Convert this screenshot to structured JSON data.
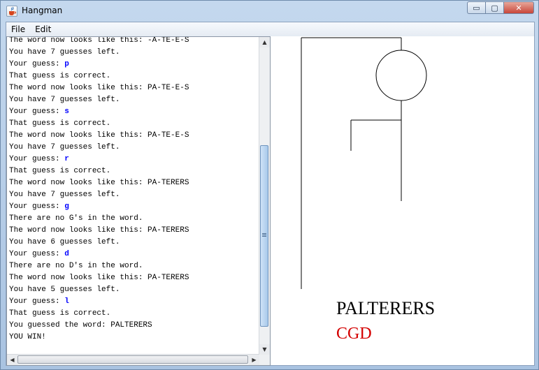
{
  "window": {
    "title": "Hangman",
    "controls": {
      "minimize": "▭",
      "maximize": "▢",
      "close": "✕"
    }
  },
  "menubar": {
    "items": [
      "File",
      "Edit"
    ]
  },
  "console": {
    "lines": [
      [
        {
          "text": "The word now looks like this: -A-TE-E-S"
        }
      ],
      [
        {
          "text": "You have 7 guesses left."
        }
      ],
      [
        {
          "text": "Your guess: "
        },
        {
          "text": "p",
          "guess": true
        }
      ],
      [
        {
          "text": "That guess is correct."
        }
      ],
      [
        {
          "text": "The word now looks like this: PA-TE-E-S"
        }
      ],
      [
        {
          "text": "You have 7 guesses left."
        }
      ],
      [
        {
          "text": "Your guess: "
        },
        {
          "text": "s",
          "guess": true
        }
      ],
      [
        {
          "text": "That guess is correct."
        }
      ],
      [
        {
          "text": "The word now looks like this: PA-TE-E-S"
        }
      ],
      [
        {
          "text": "You have 7 guesses left."
        }
      ],
      [
        {
          "text": "Your guess: "
        },
        {
          "text": "r",
          "guess": true
        }
      ],
      [
        {
          "text": "That guess is correct."
        }
      ],
      [
        {
          "text": "The word now looks like this: PA-TERERS"
        }
      ],
      [
        {
          "text": "You have 7 guesses left."
        }
      ],
      [
        {
          "text": "Your guess: "
        },
        {
          "text": "g",
          "guess": true
        }
      ],
      [
        {
          "text": "There are no G's in the word."
        }
      ],
      [
        {
          "text": "The word now looks like this: PA-TERERS"
        }
      ],
      [
        {
          "text": "You have 6 guesses left."
        }
      ],
      [
        {
          "text": "Your guess: "
        },
        {
          "text": "d",
          "guess": true
        }
      ],
      [
        {
          "text": "There are no D's in the word."
        }
      ],
      [
        {
          "text": "The word now looks like this: PA-TERERS"
        }
      ],
      [
        {
          "text": "You have 5 guesses left."
        }
      ],
      [
        {
          "text": "Your guess: "
        },
        {
          "text": "l",
          "guess": true
        }
      ],
      [
        {
          "text": "That guess is correct."
        }
      ],
      [
        {
          "text": "You guessed the word: PALTERERS"
        }
      ],
      [
        {
          "text": "YOU WIN!"
        }
      ]
    ],
    "scrollbar_position": 0.85
  },
  "canvas": {
    "word": "PALTERERS",
    "incorrect_guesses": "CGD",
    "incorrect_color": "#d40000"
  },
  "colors": {
    "guess_text": "#0000ff",
    "incorrect_guesses": "#d40000"
  }
}
